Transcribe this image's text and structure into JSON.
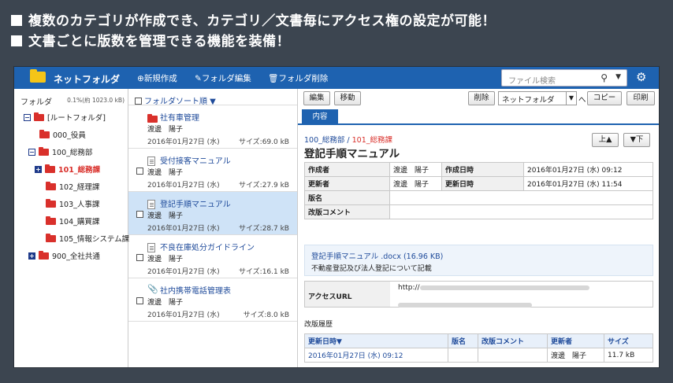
{
  "banner": {
    "line1": "複数のカテゴリが作成でき、カテゴリ／文書毎にアクセス権の設定が可能！",
    "line2": "文書ごとに版数を管理できる機能を装備！"
  },
  "topbar": {
    "app_name": "ネットフォルダ",
    "new_label": "新規作成",
    "edit_label": "フォルダ編集",
    "delete_label": "フォルダ削除",
    "search_placeholder": "ファイル検索",
    "icons": [
      "folder-icon",
      "plus-circle-icon",
      "pencil-icon",
      "trash-icon",
      "search-icon",
      "gear-icon"
    ]
  },
  "sidebar": {
    "heading": "フォルダ",
    "usage": "0.1%(約 1023.0 kB)",
    "items": [
      {
        "label": "[ルートフォルダ]",
        "toggle": "−"
      },
      {
        "label": "000_役員",
        "toggle": ""
      },
      {
        "label": "100_総務部",
        "toggle": "−"
      },
      {
        "label": "101_総務課",
        "toggle": "+"
      },
      {
        "label": "102_経理課",
        "toggle": ""
      },
      {
        "label": "103_人事課",
        "toggle": ""
      },
      {
        "label": "104_購買課",
        "toggle": ""
      },
      {
        "label": "105_情報システム課",
        "toggle": ""
      },
      {
        "label": "900_全社共通",
        "toggle": "+"
      }
    ]
  },
  "list": {
    "sort_label": "フォルダソート順 ▼",
    "items": [
      {
        "title": "社有車管理",
        "owner": "渡邊　陽子",
        "date": "2016年01月27日 (水)",
        "size": "サイズ:69.0 kB",
        "type": "folder"
      },
      {
        "title": "受付接客マニュアル",
        "owner": "渡邊　陽子",
        "date": "2016年01月27日 (水)",
        "size": "サイズ:27.9 kB",
        "type": "doc"
      },
      {
        "title": "登記手順マニュアル",
        "owner": "渡邊　陽子",
        "date": "2016年01月27日 (水)",
        "size": "サイズ:28.7 kB",
        "type": "doc"
      },
      {
        "title": "不良在庫処分ガイドライン",
        "owner": "渡邊　陽子",
        "date": "2016年01月27日 (水)",
        "size": "サイズ:16.1 kB",
        "type": "doc"
      },
      {
        "title": "社内携帯電話管理表",
        "owner": "渡邊　陽子",
        "date": "2016年01月27日 (水)",
        "size": "サイズ:8.0 kB",
        "type": "clip"
      }
    ]
  },
  "detail": {
    "buttons": {
      "edit": "編集",
      "move": "移動",
      "delete": "削除",
      "copy": "コピー",
      "print": "印刷",
      "to": "へ",
      "up": "上▲",
      "down": "▼下"
    },
    "select_value": "ネットフォルダ",
    "tab": "内容",
    "crumb_parent": "100_総務部",
    "crumb_sep": " / ",
    "crumb_current": "101_総務課",
    "title": "登記手順マニュアル",
    "meta": {
      "creator_label": "作成者",
      "creator": "渡邊　陽子",
      "created_label": "作成日時",
      "created": "2016年01月27日 (水) 09:12",
      "updater_label": "更新者",
      "updater": "渡邊　陽子",
      "updated_label": "更新日時",
      "updated": "2016年01月27日 (水) 11:54",
      "version_label": "版名",
      "comment_label": "改版コメント"
    },
    "file_name": "登記手順マニュアル .docx (16.96 KB)",
    "file_desc": "不動産登記及び法人登記について記載",
    "access_url_label": "アクセスURL",
    "access_url_prefix": "http://",
    "history_heading": "改版履歴",
    "history_columns": [
      "更新日時▼",
      "版名",
      "改版コメント",
      "更新者",
      "サイズ"
    ],
    "history_rows": [
      {
        "datetime": "2016年01月27日 (水) 09:12",
        "version": "",
        "comment": "",
        "updater": "渡邊　陽子",
        "size": "11.7 kB"
      }
    ]
  }
}
